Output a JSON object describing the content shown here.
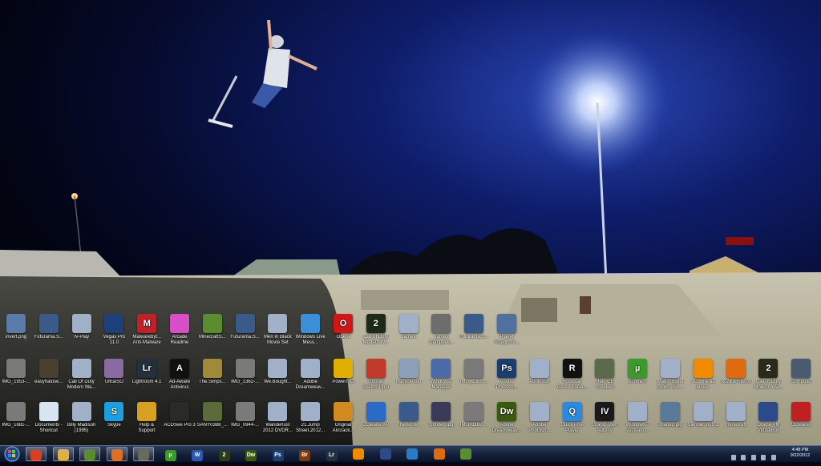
{
  "desktop": {
    "rows": [
      [
        {
          "label": "invert.png",
          "icon": "image-icon",
          "color": "#5b7ba8"
        },
        {
          "label": "Futurama.S...",
          "icon": "video-file-icon",
          "color": "#3a5a8a"
        },
        {
          "label": "IV-Play",
          "icon": "shortcut-file-icon",
          "color": "#9fb0c8"
        },
        {
          "label": "Vegas Pro 11.0",
          "icon": "vegas-pro-icon",
          "color": "#1d3f7a"
        },
        {
          "label": "Malwarebyt... Anti-Malware",
          "icon": "malwarebytes-icon",
          "color": "#c0202a",
          "glyph": "M"
        },
        {
          "label": "Arcade Readme",
          "icon": "arcade-icon",
          "color": "#d84ec8"
        },
        {
          "label": "MinecraftS...",
          "icon": "minecraft-icon",
          "color": "#5b8c2f"
        },
        {
          "label": "Futurama.S...",
          "icon": "video-file-icon",
          "color": "#3a5a8a"
        },
        {
          "label": "Men In Black Movie Set",
          "icon": "shortcut-file-icon",
          "color": "#9fb0c8"
        },
        {
          "label": "Windows Live Mess...",
          "icon": "messenger-icon",
          "color": "#3b8ed8"
        },
        {
          "label": "Opera",
          "icon": "opera-icon",
          "color": "#d01717",
          "glyph": "O"
        },
        {
          "label": "Call of Duty Modern W...",
          "icon": "cod-icon",
          "color": "#1d2a1a",
          "glyph": "2"
        },
        {
          "label": "James",
          "icon": "shortcut-file-icon",
          "color": "#9fb0c8"
        },
        {
          "label": "James Campbell...",
          "icon": "image-icon",
          "color": "#6d6d6d"
        },
        {
          "label": "Futurama.S...",
          "icon": "video-file-icon",
          "color": "#3a5a8a"
        },
        {
          "label": "Planet Assignme...",
          "icon": "document-icon",
          "color": "#5070a0"
        }
      ],
      [
        {
          "label": "IMG_1953-...",
          "icon": "image-icon",
          "color": "#7a7a7a"
        },
        {
          "label": "easyhalose...",
          "icon": "halo-file-icon",
          "color": "#4a4030"
        },
        {
          "label": "Call Of Duty Modern Wa...",
          "icon": "shortcut-file-icon",
          "color": "#9fb0c8"
        },
        {
          "label": "UltraISO",
          "icon": "disc-icon",
          "color": "#8a6aa0"
        },
        {
          "label": "Lightroom 4.1",
          "icon": "lightroom-icon",
          "color": "#23313f",
          "glyph": "Lr"
        },
        {
          "label": "Ad-Aware Antivirus",
          "icon": "adaware-icon",
          "color": "#111111",
          "glyph": "A"
        },
        {
          "label": "The.Simps...",
          "icon": "video-file-icon",
          "color": "#a08a3a"
        },
        {
          "label": "IMG_1362-...",
          "icon": "image-icon",
          "color": "#7a7a7a"
        },
        {
          "label": "We.Bought...",
          "icon": "shortcut-file-icon",
          "color": "#9fb0c8"
        },
        {
          "label": "Adobe Dreamweav...",
          "icon": "shortcut-file-icon",
          "color": "#9fb0c8"
        },
        {
          "label": "PowerISO",
          "icon": "poweriso-icon",
          "color": "#e0b000"
        },
        {
          "label": "Google Sketch-Up 8",
          "icon": "sketchup-icon",
          "color": "#c03a2a"
        },
        {
          "label": "Recycle Bin",
          "icon": "recycle-bin-icon",
          "color": "#8aa0b8"
        },
        {
          "label": "Windows7 Manager",
          "icon": "tools-icon",
          "color": "#4a6aa8"
        },
        {
          "label": "IMG_1368-...",
          "icon": "image-icon",
          "color": "#7a7a7a"
        },
        {
          "label": "Adobe Photosh...",
          "icon": "photoshop-icon",
          "color": "#1b3d6f",
          "glyph": "Ps"
        },
        {
          "label": "Audiosurf",
          "icon": "shortcut-file-icon",
          "color": "#9fb0c8"
        },
        {
          "label": "Rockstar Game Socia...",
          "icon": "rockstar-icon",
          "color": "#111111",
          "glyph": "R"
        },
        {
          "label": "Halo CE Cracked",
          "icon": "halo-icon",
          "color": "#5a6a4a"
        },
        {
          "label": "µTorrent",
          "icon": "utorrent-icon",
          "color": "#3a9a2a",
          "glyph": "µ"
        },
        {
          "label": "Magic Bullet Looks x64 ...",
          "icon": "shortcut-file-icon",
          "color": "#9fb0c8"
        },
        {
          "label": "VLC media player",
          "icon": "vlc-icon",
          "color": "#f08a00"
        },
        {
          "label": "Mozilla Firefox",
          "icon": "firefox-icon",
          "color": "#e06a10"
        },
        {
          "label": "Call of Duty Modern Wa...",
          "icon": "cod-icon",
          "color": "#2a2a1a",
          "glyph": "2"
        },
        {
          "label": "Computer",
          "icon": "computer-icon",
          "color": "#4a5a70"
        }
      ],
      [
        {
          "label": "IMG_1681-...",
          "icon": "image-icon",
          "color": "#7a7a7a"
        },
        {
          "label": "Documents - Shortcut",
          "icon": "documents-icon",
          "color": "#d8e4f0"
        },
        {
          "label": "Billy Madison (1995)",
          "icon": "shortcut-file-icon",
          "color": "#9fb0c8"
        },
        {
          "label": "Skype",
          "icon": "skype-icon",
          "color": "#1aa0e0",
          "glyph": "S"
        },
        {
          "label": "Help & Support",
          "icon": "chrome-icon",
          "color": "#d8a020"
        },
        {
          "label": "ACDSee Pro 3",
          "icon": "acdsee-icon",
          "color": "#2a2a2a"
        },
        {
          "label": "SANY0388_...",
          "icon": "video-file-icon",
          "color": "#5a6a3a"
        },
        {
          "label": "IMG_0944-...",
          "icon": "image-icon",
          "color": "#7a7a7a"
        },
        {
          "label": "Wanderlust 2012 DVDR...",
          "icon": "shortcut-file-icon",
          "color": "#9fb0c8"
        },
        {
          "label": "21.Jump Street.2012...",
          "icon": "shortcut-file-icon",
          "color": "#9fb0c8"
        },
        {
          "label": "Original Aircrack...",
          "icon": "aircrack-icon",
          "color": "#d08a20"
        },
        {
          "label": "CCleanerXP",
          "icon": "network-icon",
          "color": "#2a6ac8"
        },
        {
          "label": "Network",
          "icon": "network-icon",
          "color": "#3a5a8a"
        },
        {
          "label": "Untitled.jpg",
          "icon": "image-icon",
          "color": "#3a3a5a"
        },
        {
          "label": "IMG_1162-...",
          "icon": "image-icon",
          "color": "#7a7a7a"
        },
        {
          "label": "Adobe Dreamweav...",
          "icon": "dreamweaver-icon",
          "color": "#3a5a10",
          "glyph": "Dw"
        },
        {
          "label": "Adobe Photosh...",
          "icon": "shortcut-file-icon",
          "color": "#9fb0c8"
        },
        {
          "label": "QuickTime Player",
          "icon": "quicktime-icon",
          "color": "#2a8ae0",
          "glyph": "Q"
        },
        {
          "label": "Grand Theft Auto IV",
          "icon": "gta-icon",
          "color": "#1a1a1a",
          "glyph": "IV"
        },
        {
          "label": "Windows 7 Activato...",
          "icon": "shortcut-file-icon",
          "color": "#9fb0c8"
        },
        {
          "label": "image2.jpg",
          "icon": "image-icon",
          "color": "#5a7a9a"
        },
        {
          "label": "Slender v0.9.1",
          "icon": "shortcut-file-icon",
          "color": "#9fb0c8"
        },
        {
          "label": ".minecraft",
          "icon": "shortcut-file-icon",
          "color": "#9fb0c8"
        },
        {
          "label": "Oracle VM VirtualBox",
          "icon": "virtualbox-icon",
          "color": "#2a4a8a"
        },
        {
          "label": "CCleaner",
          "icon": "ccleaner-icon",
          "color": "#c02020"
        }
      ]
    ]
  },
  "taskbar": {
    "items": [
      {
        "icon": "chrome-icon",
        "color": "#d84020",
        "active": true
      },
      {
        "icon": "folder-icon",
        "color": "#e0b040",
        "active": true
      },
      {
        "icon": "minecraft-icon",
        "color": "#5b8c2f",
        "active": true
      },
      {
        "icon": "media-player-icon",
        "color": "#e07020",
        "active": true
      },
      {
        "icon": "halo-icon",
        "color": "#6a6a5a",
        "active": true
      },
      {
        "icon": "utorrent-icon",
        "color": "#3a9a2a",
        "glyph": "µ",
        "active": false
      },
      {
        "icon": "word-icon",
        "color": "#2a5ab8",
        "glyph": "W",
        "active": false
      },
      {
        "icon": "cod-icon",
        "color": "#2a3a1a",
        "glyph": "2",
        "active": false
      },
      {
        "icon": "dreamweaver-icon",
        "color": "#3a5a10",
        "glyph": "Dw",
        "active": false
      },
      {
        "icon": "photoshop-icon",
        "color": "#1b3d6f",
        "glyph": "Ps",
        "active": false
      },
      {
        "icon": "bridge-icon",
        "color": "#7a3a10",
        "glyph": "Br",
        "active": false
      },
      {
        "icon": "lightroom-icon",
        "color": "#23313f",
        "glyph": "Lr",
        "active": false
      },
      {
        "icon": "vlc-icon",
        "color": "#f08a00",
        "active": false
      },
      {
        "icon": "virtualbox-icon",
        "color": "#2a4a8a",
        "active": false
      },
      {
        "icon": "globe-icon",
        "color": "#2a7ac8",
        "active": false
      },
      {
        "icon": "firefox-icon",
        "color": "#e06a10",
        "active": false
      },
      {
        "icon": "minecraft-icon",
        "color": "#5b8c2f",
        "active": false
      }
    ],
    "clock": {
      "time": "4:48 PM",
      "date": "9/22/2012"
    }
  }
}
